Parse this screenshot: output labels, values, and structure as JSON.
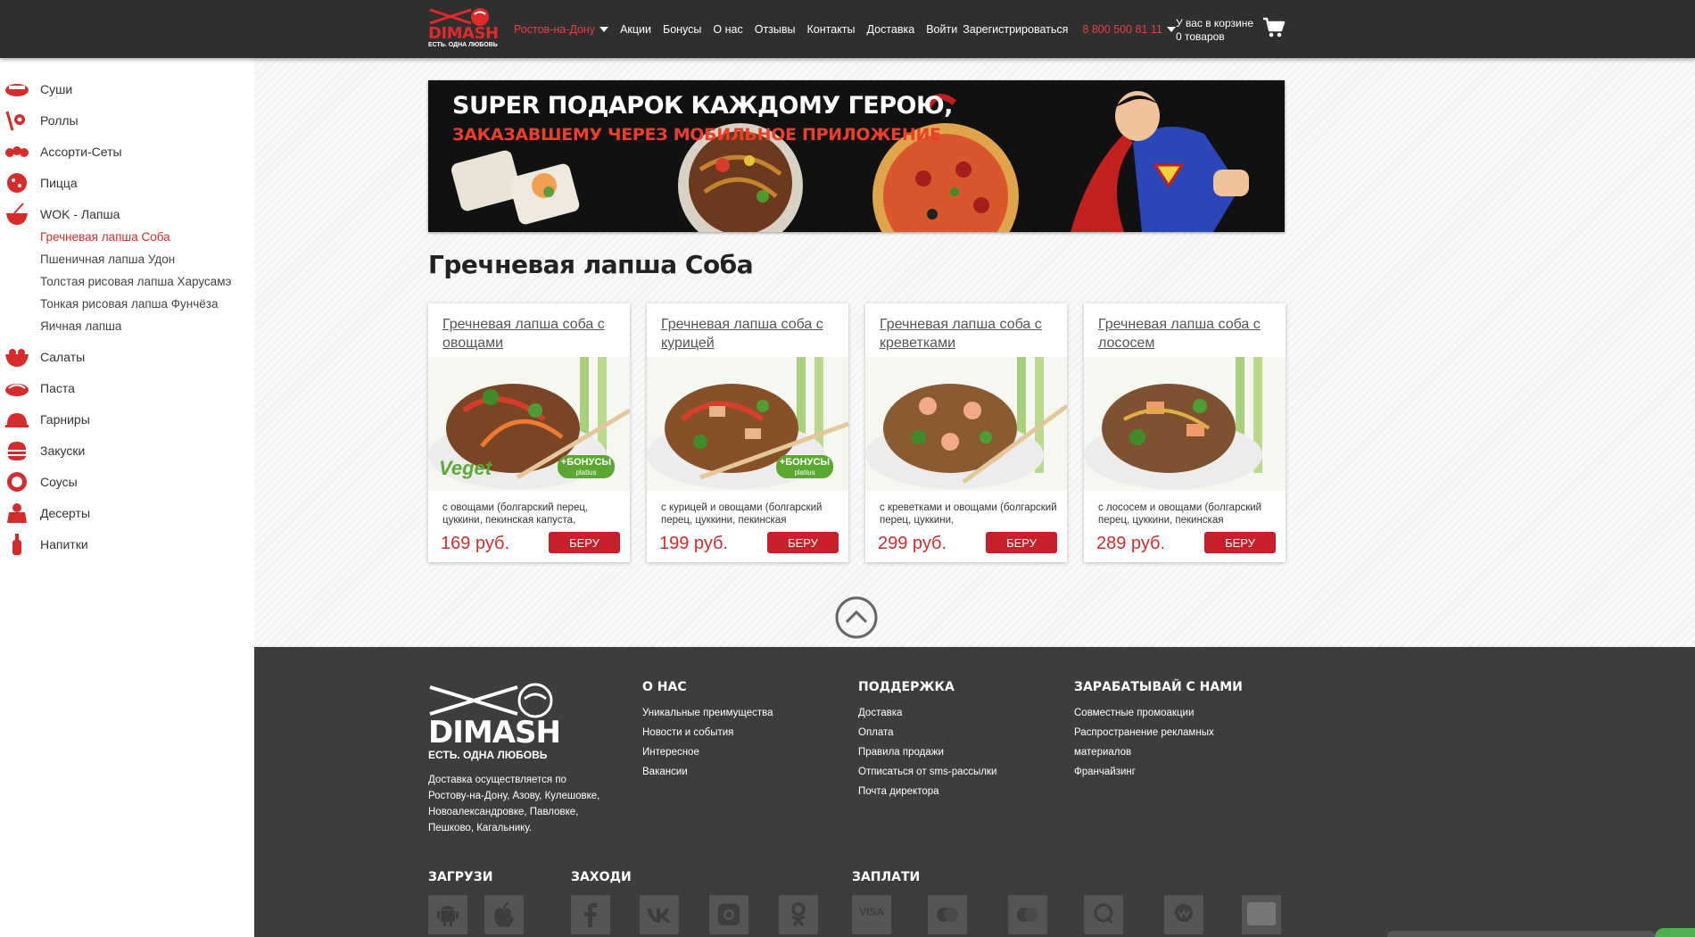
{
  "header": {
    "logo_brand": "DIMASH",
    "logo_tagline": "ЕСТЬ. ОДНА ЛЮБОВЬ",
    "city": "Ростов-на-Дону",
    "nav": [
      "Акции",
      "Бонусы",
      "О нас",
      "Отзывы",
      "Контакты",
      "Доставка",
      "Войти",
      "Зарегистрироваться"
    ],
    "phone": "8 800 500 81 11",
    "cart_line1": "У вас в корзине",
    "cart_line2": "0 товаров"
  },
  "sidebar": {
    "categories": [
      {
        "label": "Суши",
        "icon": "sushi-icon"
      },
      {
        "label": "Роллы",
        "icon": "rolls-icon"
      },
      {
        "label": "Ассорти-Сеты",
        "icon": "sets-icon"
      },
      {
        "label": "Пицца",
        "icon": "pizza-icon"
      },
      {
        "label": "WOK - Лапша",
        "icon": "wok-icon"
      },
      {
        "label": "Салаты",
        "icon": "salad-icon"
      },
      {
        "label": "Паста",
        "icon": "pasta-icon"
      },
      {
        "label": "Гарниры",
        "icon": "garnish-icon"
      },
      {
        "label": "Закуски",
        "icon": "snacks-icon"
      },
      {
        "label": "Соусы",
        "icon": "sauce-icon"
      },
      {
        "label": "Десерты",
        "icon": "dessert-icon"
      },
      {
        "label": "Напитки",
        "icon": "drinks-icon"
      }
    ],
    "wok_sub": [
      {
        "label": "Гречневая лапша Соба",
        "active": true
      },
      {
        "label": "Пшеничная лапша Удон",
        "active": false
      },
      {
        "label": "Толстая рисовая лапша Харусамэ",
        "active": false
      },
      {
        "label": "Тонкая рисовая лапша Фунчёза",
        "active": false
      },
      {
        "label": "Яичная лапша",
        "active": false
      }
    ]
  },
  "banner": {
    "line1": "SUPER ПОДАРОК КАЖДОМУ ГЕРОЮ,",
    "line2": "ЗАКАЗАВШЕМУ ЧЕРЕЗ МОБИЛЬНОЕ ПРИЛОЖЕНИЕ"
  },
  "page_title": "Гречневая лапша Соба",
  "products": [
    {
      "name": "Гречневая лапша соба с овощами",
      "desc": "с овощами (болгарский перец, цуккини, пекинская капуста,",
      "price": "169 руб.",
      "buy": "БЕРУ",
      "badge": "+БОНУСЫ",
      "badge_sub": "platius",
      "veget": "Veget"
    },
    {
      "name": "Гречневая лапша соба с курицей",
      "desc": "с курицей и овощами (болгарский перец, цуккини, пекинская",
      "price": "199 руб.",
      "buy": "БЕРУ",
      "badge": "+БОНУСЫ",
      "badge_sub": "platius",
      "veget": ""
    },
    {
      "name": "Гречневая лапша соба с креветками",
      "desc": "с креветками и овощами (болгарский перец, цуккини,",
      "price": "299 руб.",
      "buy": "БЕРУ",
      "badge": "",
      "badge_sub": "",
      "veget": ""
    },
    {
      "name": "Гречневая лапша соба с лососем",
      "desc": "с лососем и овощами (болгарский перец, цуккини, пекинская",
      "price": "289 руб.",
      "buy": "БЕРУ",
      "badge": "",
      "badge_sub": "",
      "veget": ""
    }
  ],
  "footer": {
    "logo_brand": "DIMASH",
    "logo_tagline": "ЕСТЬ. ОДНА ЛЮБОВЬ",
    "delivery": "Доставка осуществляется по Ростову-на-Дону, Азову, Кулешовке, Новоалександровке, Павловке, Пешково, Кагальнику.",
    "about_title": "О НАС",
    "about": [
      "Уникальные преимущества",
      "Новости и события",
      "Интересное",
      "Вакансии"
    ],
    "support_title": "ПОДДЕРЖКА",
    "support": [
      "Доставка",
      "Оплата",
      "Правила продажи",
      "Отписаться от sms-рассылки",
      "Почта директора"
    ],
    "earn_title": "ЗАРАБАТЫВАЙ С НАМИ",
    "earn": [
      "Совместные промоакции",
      "Распространение рекламных материалов",
      "Франчайзинг"
    ],
    "download_title": "ЗАГРУЗИ",
    "visit_title": "ЗАХОДИ",
    "pay_title": "ЗАПЛАТИ",
    "pay_visa": "VISA"
  },
  "colors": {
    "accent": "#d62b2b",
    "header_bg": "#2f2f2f",
    "footer_bg": "#3d3d3d"
  }
}
